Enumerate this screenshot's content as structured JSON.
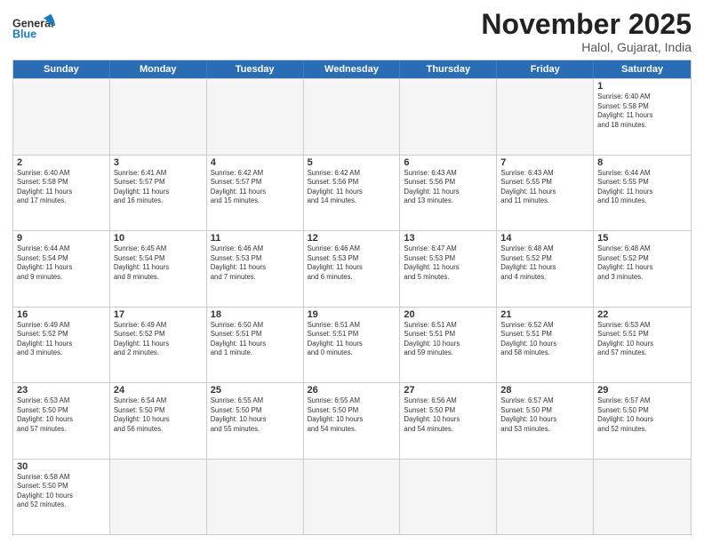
{
  "header": {
    "logo_general": "General",
    "logo_blue": "Blue",
    "month_title": "November 2025",
    "location": "Halol, Gujarat, India"
  },
  "weekdays": [
    "Sunday",
    "Monday",
    "Tuesday",
    "Wednesday",
    "Thursday",
    "Friday",
    "Saturday"
  ],
  "rows": [
    [
      {
        "day": "",
        "info": "",
        "empty": true
      },
      {
        "day": "",
        "info": "",
        "empty": true
      },
      {
        "day": "",
        "info": "",
        "empty": true
      },
      {
        "day": "",
        "info": "",
        "empty": true
      },
      {
        "day": "",
        "info": "",
        "empty": true
      },
      {
        "day": "",
        "info": "",
        "empty": true
      },
      {
        "day": "1",
        "info": "Sunrise: 6:40 AM\nSunset: 5:58 PM\nDaylight: 11 hours\nand 18 minutes.",
        "empty": false
      }
    ],
    [
      {
        "day": "2",
        "info": "Sunrise: 6:40 AM\nSunset: 5:58 PM\nDaylight: 11 hours\nand 17 minutes.",
        "empty": false
      },
      {
        "day": "3",
        "info": "Sunrise: 6:41 AM\nSunset: 5:57 PM\nDaylight: 11 hours\nand 16 minutes.",
        "empty": false
      },
      {
        "day": "4",
        "info": "Sunrise: 6:42 AM\nSunset: 5:57 PM\nDaylight: 11 hours\nand 15 minutes.",
        "empty": false
      },
      {
        "day": "5",
        "info": "Sunrise: 6:42 AM\nSunset: 5:56 PM\nDaylight: 11 hours\nand 14 minutes.",
        "empty": false
      },
      {
        "day": "6",
        "info": "Sunrise: 6:43 AM\nSunset: 5:56 PM\nDaylight: 11 hours\nand 13 minutes.",
        "empty": false
      },
      {
        "day": "7",
        "info": "Sunrise: 6:43 AM\nSunset: 5:55 PM\nDaylight: 11 hours\nand 11 minutes.",
        "empty": false
      },
      {
        "day": "8",
        "info": "Sunrise: 6:44 AM\nSunset: 5:55 PM\nDaylight: 11 hours\nand 10 minutes.",
        "empty": false
      }
    ],
    [
      {
        "day": "9",
        "info": "Sunrise: 6:44 AM\nSunset: 5:54 PM\nDaylight: 11 hours\nand 9 minutes.",
        "empty": false
      },
      {
        "day": "10",
        "info": "Sunrise: 6:45 AM\nSunset: 5:54 PM\nDaylight: 11 hours\nand 8 minutes.",
        "empty": false
      },
      {
        "day": "11",
        "info": "Sunrise: 6:46 AM\nSunset: 5:53 PM\nDaylight: 11 hours\nand 7 minutes.",
        "empty": false
      },
      {
        "day": "12",
        "info": "Sunrise: 6:46 AM\nSunset: 5:53 PM\nDaylight: 11 hours\nand 6 minutes.",
        "empty": false
      },
      {
        "day": "13",
        "info": "Sunrise: 6:47 AM\nSunset: 5:53 PM\nDaylight: 11 hours\nand 5 minutes.",
        "empty": false
      },
      {
        "day": "14",
        "info": "Sunrise: 6:48 AM\nSunset: 5:52 PM\nDaylight: 11 hours\nand 4 minutes.",
        "empty": false
      },
      {
        "day": "15",
        "info": "Sunrise: 6:48 AM\nSunset: 5:52 PM\nDaylight: 11 hours\nand 3 minutes.",
        "empty": false
      }
    ],
    [
      {
        "day": "16",
        "info": "Sunrise: 6:49 AM\nSunset: 5:52 PM\nDaylight: 11 hours\nand 3 minutes.",
        "empty": false
      },
      {
        "day": "17",
        "info": "Sunrise: 6:49 AM\nSunset: 5:52 PM\nDaylight: 11 hours\nand 2 minutes.",
        "empty": false
      },
      {
        "day": "18",
        "info": "Sunrise: 6:50 AM\nSunset: 5:51 PM\nDaylight: 11 hours\nand 1 minute.",
        "empty": false
      },
      {
        "day": "19",
        "info": "Sunrise: 6:51 AM\nSunset: 5:51 PM\nDaylight: 11 hours\nand 0 minutes.",
        "empty": false
      },
      {
        "day": "20",
        "info": "Sunrise: 6:51 AM\nSunset: 5:51 PM\nDaylight: 10 hours\nand 59 minutes.",
        "empty": false
      },
      {
        "day": "21",
        "info": "Sunrise: 6:52 AM\nSunset: 5:51 PM\nDaylight: 10 hours\nand 58 minutes.",
        "empty": false
      },
      {
        "day": "22",
        "info": "Sunrise: 6:53 AM\nSunset: 5:51 PM\nDaylight: 10 hours\nand 57 minutes.",
        "empty": false
      }
    ],
    [
      {
        "day": "23",
        "info": "Sunrise: 6:53 AM\nSunset: 5:50 PM\nDaylight: 10 hours\nand 57 minutes.",
        "empty": false
      },
      {
        "day": "24",
        "info": "Sunrise: 6:54 AM\nSunset: 5:50 PM\nDaylight: 10 hours\nand 56 minutes.",
        "empty": false
      },
      {
        "day": "25",
        "info": "Sunrise: 6:55 AM\nSunset: 5:50 PM\nDaylight: 10 hours\nand 55 minutes.",
        "empty": false
      },
      {
        "day": "26",
        "info": "Sunrise: 6:55 AM\nSunset: 5:50 PM\nDaylight: 10 hours\nand 54 minutes.",
        "empty": false
      },
      {
        "day": "27",
        "info": "Sunrise: 6:56 AM\nSunset: 5:50 PM\nDaylight: 10 hours\nand 54 minutes.",
        "empty": false
      },
      {
        "day": "28",
        "info": "Sunrise: 6:57 AM\nSunset: 5:50 PM\nDaylight: 10 hours\nand 53 minutes.",
        "empty": false
      },
      {
        "day": "29",
        "info": "Sunrise: 6:57 AM\nSunset: 5:50 PM\nDaylight: 10 hours\nand 52 minutes.",
        "empty": false
      }
    ],
    [
      {
        "day": "30",
        "info": "Sunrise: 6:58 AM\nSunset: 5:50 PM\nDaylight: 10 hours\nand 52 minutes.",
        "empty": false
      },
      {
        "day": "",
        "info": "",
        "empty": true
      },
      {
        "day": "",
        "info": "",
        "empty": true
      },
      {
        "day": "",
        "info": "",
        "empty": true
      },
      {
        "day": "",
        "info": "",
        "empty": true
      },
      {
        "day": "",
        "info": "",
        "empty": true
      },
      {
        "day": "",
        "info": "",
        "empty": true
      }
    ]
  ]
}
